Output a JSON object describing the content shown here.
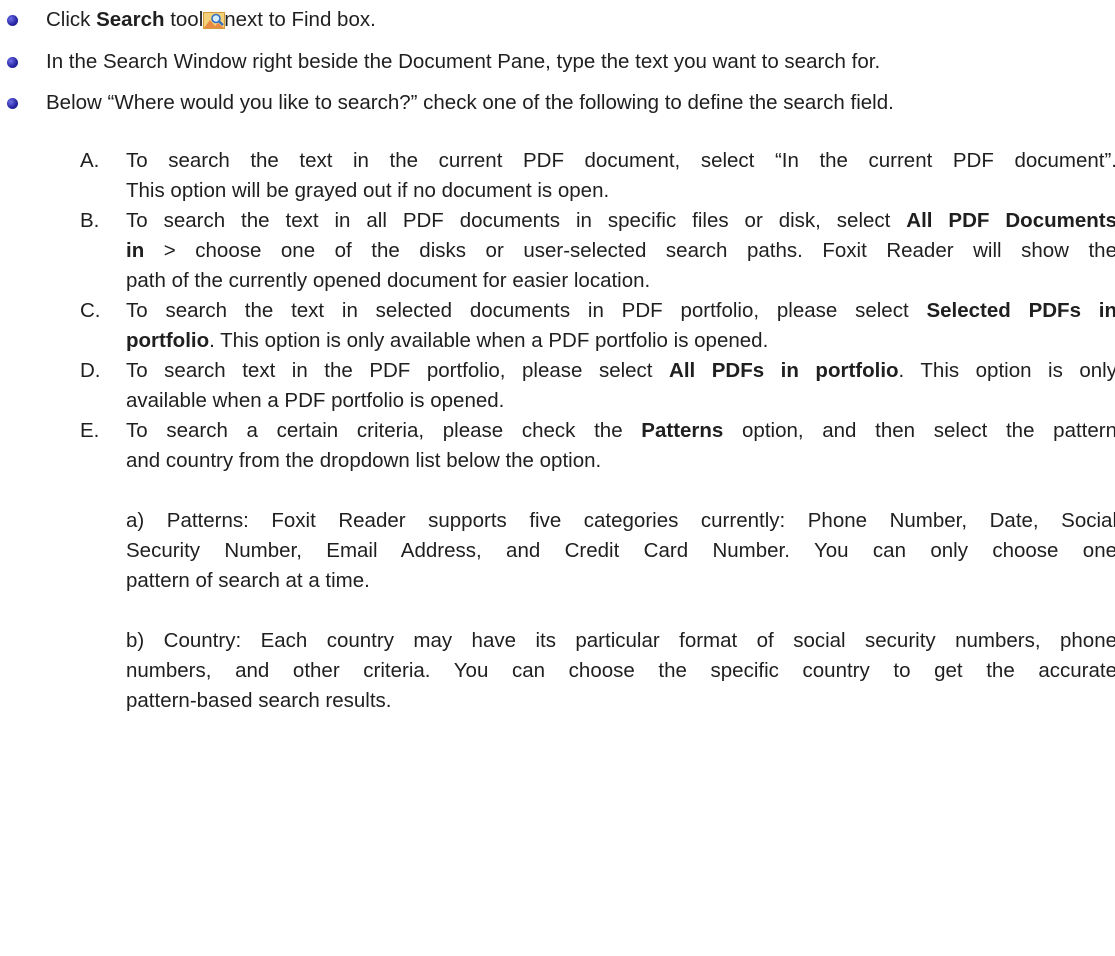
{
  "bullets": {
    "b1": {
      "pre": "Click ",
      "bold": "Search",
      "mid": " tool",
      "post": "next to Find box."
    },
    "b2": {
      "text": "In the Search Window right beside the Document Pane, type the text you want to search for."
    },
    "b3": {
      "text": "Below “Where would you like to search?” check one of the following to define the search field."
    }
  },
  "items": {
    "A": {
      "marker": "A.",
      "l1": "To search the text in the current PDF document, select “In the current PDF document”.",
      "l2": "This option will be grayed out if no document is open."
    },
    "B": {
      "marker": "B.",
      "l1_pre": "To search the text in all PDF documents in specific files or disk, select ",
      "l1_bold": "All PDF Documents",
      "l2_bold": "in",
      "l2_post": " > choose one of the disks or user-selected search paths. Foxit Reader will show the",
      "l3": "path of the currently opened document for easier location."
    },
    "C": {
      "marker": "C.",
      "l1_pre": "To search the text in selected documents in PDF portfolio, please select ",
      "l1_bold": "Selected PDFs in",
      "l2_bold": "portfolio",
      "l2_post": ". This option is only available when a PDF portfolio is opened."
    },
    "D": {
      "marker": "D.",
      "l1_pre": "To search text in the PDF portfolio, please select ",
      "l1_bold": "All PDFs in portfolio",
      "l1_post": ". This option is only",
      "l2": "available when a PDF portfolio is opened."
    },
    "E": {
      "marker": "E.",
      "l1_pre": "To search a certain criteria, please check the ",
      "l1_bold": "Patterns",
      "l1_post": " option, and then select the pattern",
      "l2": "and country from the dropdown list below the option."
    }
  },
  "subitems": {
    "a": {
      "l1": "a) Patterns: Foxit Reader supports five categories currently: Phone Number, Date, Social",
      "l2": "Security Number, Email Address, and Credit Card Number. You can only choose one",
      "l3": "pattern of search at a time."
    },
    "b": {
      "l1": "b) Country: Each country may have its particular format of social security numbers, phone",
      "l2": "numbers, and other criteria. You can choose the specific country to get the accurate",
      "l3": "pattern-based search results."
    }
  },
  "icons": {
    "search_tool": "search-tool-icon",
    "bullet": "bullet-dot-icon"
  },
  "colors": {
    "text": "#1f1f1f",
    "bullet": "#2a2aa8"
  }
}
